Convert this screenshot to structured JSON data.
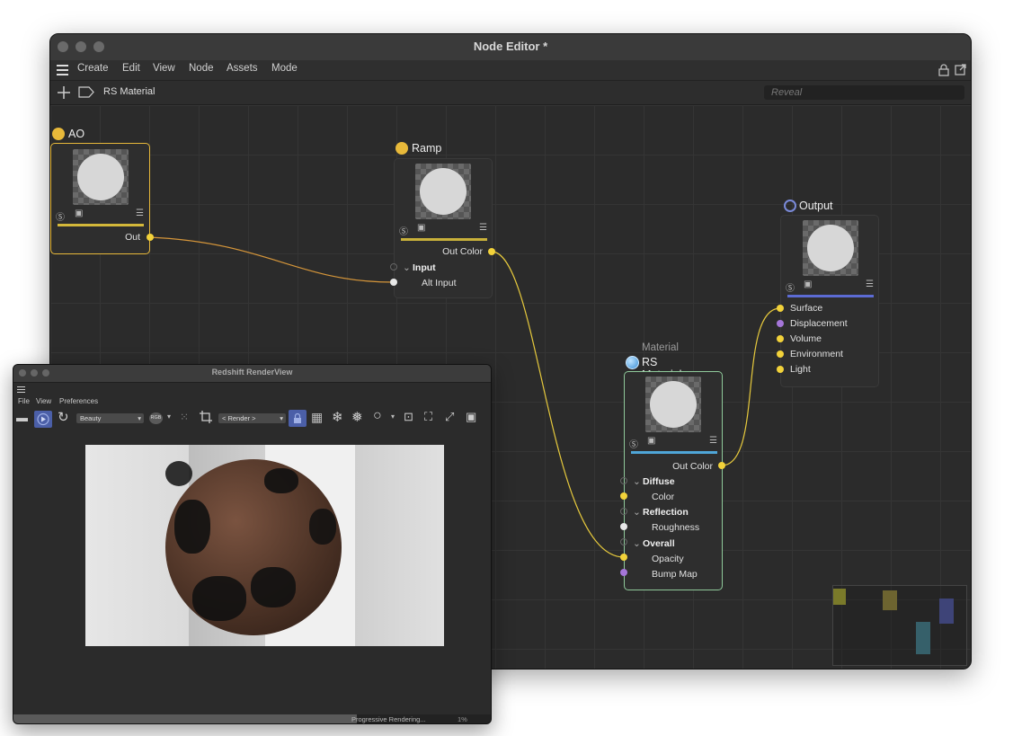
{
  "node_editor": {
    "title": "Node Editor *",
    "menu": [
      "Create",
      "Edit",
      "View",
      "Node",
      "Assets",
      "Mode"
    ],
    "breadcrumb": "RS Material",
    "search_placeholder": "Reveal",
    "nodes": {
      "ao": {
        "title": "AO",
        "out": "Out"
      },
      "ramp": {
        "title": "Ramp",
        "out": "Out Color",
        "group": "Input",
        "alt_input": "Alt Input"
      },
      "output": {
        "title": "Output",
        "ports": [
          "Surface",
          "Displacement",
          "Volume",
          "Environment",
          "Light"
        ]
      },
      "rs_material": {
        "category": "Material",
        "title": "RS Material",
        "out": "Out Color",
        "groups": [
          {
            "label": "Diffuse",
            "ports": [
              "Color"
            ]
          },
          {
            "label": "Reflection",
            "ports": [
              "Roughness"
            ]
          },
          {
            "label": "Overall",
            "ports": [
              "Opacity",
              "Bump Map"
            ]
          }
        ]
      }
    }
  },
  "render_view": {
    "title": "Redshift RenderView",
    "menu": [
      "File",
      "View",
      "Preferences"
    ],
    "aov": "Beauty",
    "rgb": "RGB",
    "camera": "< Render >",
    "status": "Progressive Rendering...",
    "progress": "1%",
    "progress_value": 0.72
  },
  "colors": {
    "ao_accent": "#e8b93a",
    "ramp_accent": "#c9b13a",
    "output_accent": "#5c6bd4",
    "material_accent": "#4fa6d8",
    "material_border": "#8fc99a",
    "wire_yellow": "#e6c93d",
    "wire_orange": "#d4953a"
  }
}
